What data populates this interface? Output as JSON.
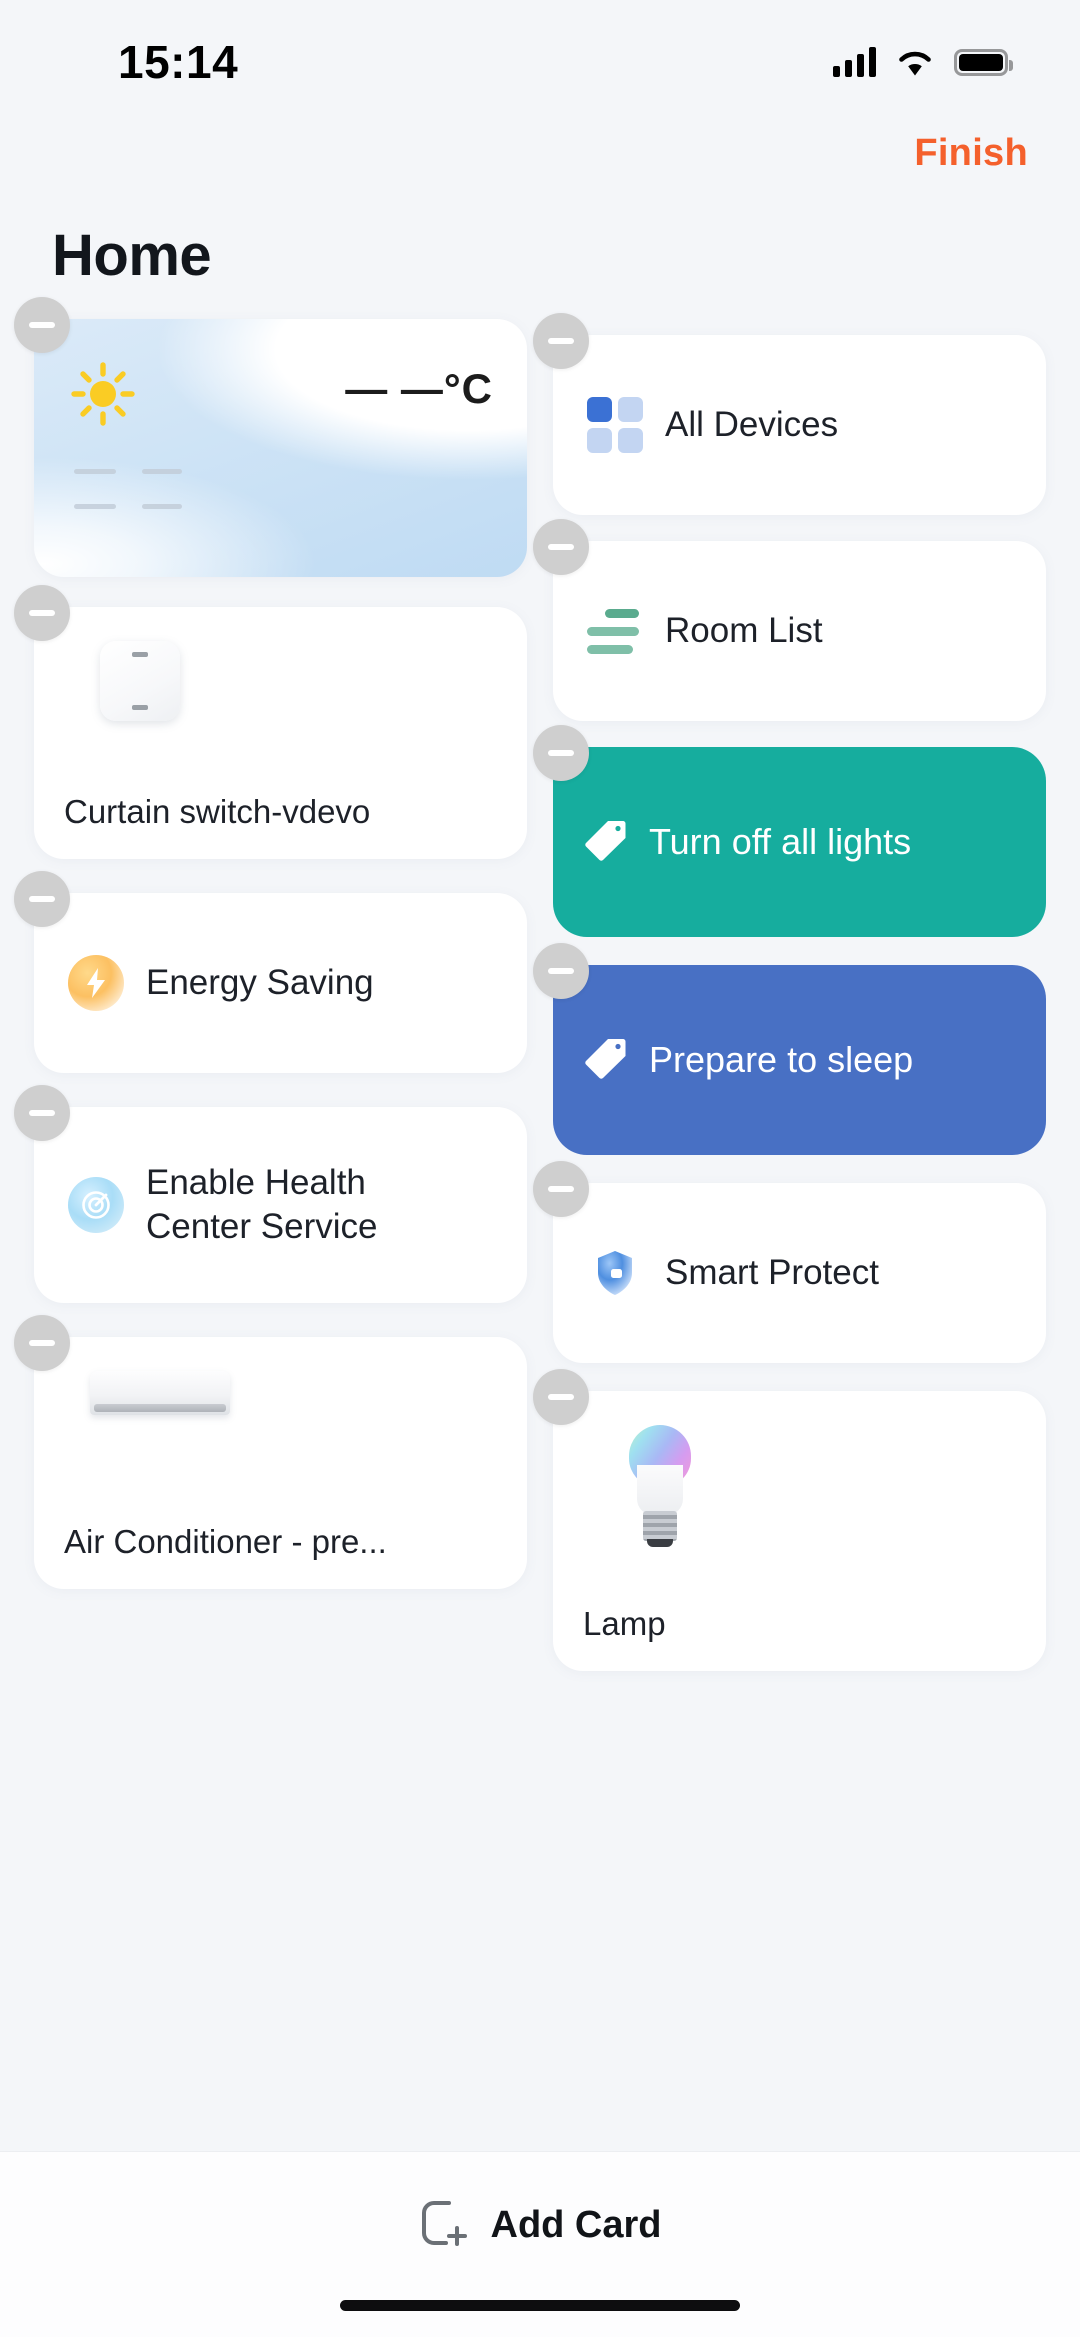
{
  "status_bar": {
    "time": "15:14",
    "icons": [
      "cellular-signal-icon",
      "wifi-icon",
      "battery-icon"
    ]
  },
  "header": {
    "finish_label": "Finish",
    "finish_color": "#f4602c",
    "title": "Home"
  },
  "weather_card": {
    "icon": "sun-icon",
    "temperature": "— —°C",
    "placeholder_rows": 2,
    "placeholders_per_row": 2
  },
  "cards": {
    "all_devices": {
      "label": "All Devices",
      "icon": "grid-squares-icon"
    },
    "room_list": {
      "label": "Room List",
      "icon": "room-bars-icon"
    },
    "turn_off_all_lights": {
      "label": "Turn off all lights",
      "icon": "tag-icon",
      "color": "#16ad9e"
    },
    "prepare_to_sleep": {
      "label": "Prepare to sleep",
      "icon": "tag-icon",
      "color": "#4870c4"
    },
    "curtain_switch": {
      "label": "Curtain switch-vdevo",
      "icon": "wall-switch-icon"
    },
    "energy_saving": {
      "label": "Energy Saving",
      "icon": "lightning-bolt-icon"
    },
    "smart_protect": {
      "label": "Smart Protect",
      "icon": "shield-icon"
    },
    "health_center": {
      "label": "Enable Health Center Service",
      "label_line1": "Enable Health",
      "label_line2": "Center Service",
      "icon": "target-icon"
    },
    "lamp": {
      "label": "Lamp",
      "icon": "rgb-bulb-icon"
    },
    "air_conditioner": {
      "label": "Air Conditioner - pre...",
      "icon": "air-conditioner-icon"
    }
  },
  "remove_badge": {
    "icon": "minus-circle-icon"
  },
  "bottom_bar": {
    "add_card_label": "Add Card",
    "add_card_icon": "add-card-icon"
  }
}
